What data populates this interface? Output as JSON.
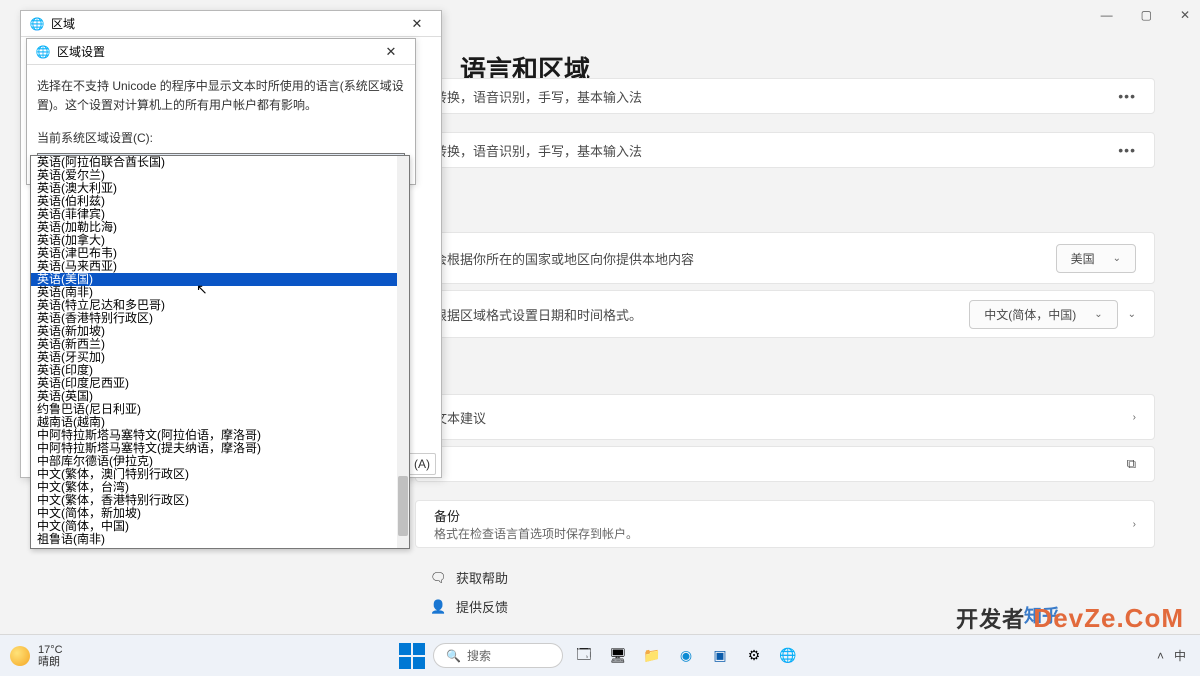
{
  "settings": {
    "title": "语言和区域",
    "card1_text": "转换，语音识别，手写，基本输入法",
    "card2_text": "转换，语音识别，手写，基本输入法",
    "card3_text": "会根据你所在的国家或地区向你提供本地内容",
    "card3_dropdown": "美国",
    "card4_text": "根据区域格式设置日期和时间格式。",
    "card4_dropdown": "中文(简体，中国)",
    "card5_text": "文本建议",
    "card7_title": "备份",
    "card7_sub": "格式在检查语言首选项时保存到帐户。",
    "help_link": "获取帮助",
    "feedback_link": "提供反馈"
  },
  "region_dialog": {
    "title": "区域",
    "inner_title": "区域设置",
    "description": "选择在不支持 Unicode 的程序中显示文本时所使用的语言(系统区域设置)。这个设置对计算机上的所有用户帐户都有影响。",
    "label": "当前系统区域设置(C):",
    "selected": "中文(简体，中国)",
    "apply_fragment": "(A)"
  },
  "locales": [
    "英语(阿拉伯联合酋长国)",
    "英语(爱尔兰)",
    "英语(澳大利亚)",
    "英语(伯利兹)",
    "英语(菲律宾)",
    "英语(加勒比海)",
    "英语(加拿大)",
    "英语(津巴布韦)",
    "英语(马来西亚)",
    "英语(美国)",
    "英语(南非)",
    "英语(特立尼达和多巴哥)",
    "英语(香港特别行政区)",
    "英语(新加坡)",
    "英语(新西兰)",
    "英语(牙买加)",
    "英语(印度)",
    "英语(印度尼西亚)",
    "英语(英国)",
    "约鲁巴语(尼日利亚)",
    "越南语(越南)",
    "中阿特拉斯塔马塞特文(阿拉伯语，摩洛哥)",
    "中阿特拉斯塔马塞特文(提夫纳语，摩洛哥)",
    "中部库尔德语(伊拉克)",
    "中文(繁体，澳门特别行政区)",
    "中文(繁体，台湾)",
    "中文(繁体，香港特别行政区)",
    "中文(简体，新加坡)",
    "中文(简体，中国)",
    "祖鲁语(南非)"
  ],
  "locale_selected_index": 9,
  "taskbar": {
    "temp": "17°C",
    "weather": "晴朗",
    "search_placeholder": "搜索",
    "lang": "中"
  },
  "watermark": {
    "w1": "知乎",
    "w2": "DevZe.CoM",
    "w2b": "开发者"
  }
}
